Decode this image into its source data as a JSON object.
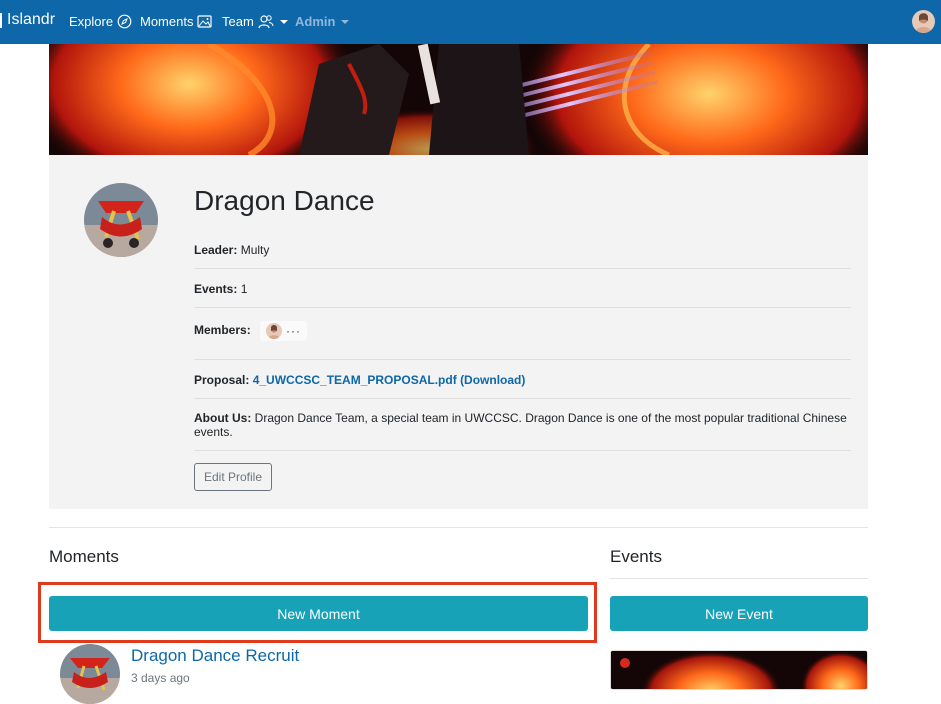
{
  "navbar": {
    "brand": "Islandr",
    "items": [
      {
        "label": "Explore",
        "icon": "compass-icon"
      },
      {
        "label": "Moments",
        "icon": "image-icon"
      },
      {
        "label": "Team",
        "icon": "team-icon"
      },
      {
        "label": "Admin",
        "icon": "caret-down-icon"
      }
    ],
    "bg_color": "#0d67a8"
  },
  "team": {
    "name": "Dragon Dance",
    "leader_label": "Leader:",
    "leader": "Multy",
    "events_label": "Events:",
    "events_count": "1",
    "members_label": "Members:",
    "members_more": "···",
    "proposal_label": "Proposal:",
    "proposal_file": "4_UWCCSC_TEAM_PROPOSAL.pdf",
    "proposal_download": "(Download)",
    "about_label": "About Us:",
    "about_text": "Dragon Dance Team, a special team in UWCCSC. Dragon Dance is one of the most popular traditional Chinese events.",
    "edit_button": "Edit Profile"
  },
  "moments": {
    "title": "Moments",
    "new_button": "New Moment",
    "items": [
      {
        "title": "Dragon Dance Recruit",
        "time": "3 days ago"
      }
    ]
  },
  "events": {
    "title": "Events",
    "new_button": "New Event"
  },
  "colors": {
    "accent_teal": "#17a2b8",
    "link_blue": "#0d67a8",
    "highlight_red": "#e03a1e"
  }
}
